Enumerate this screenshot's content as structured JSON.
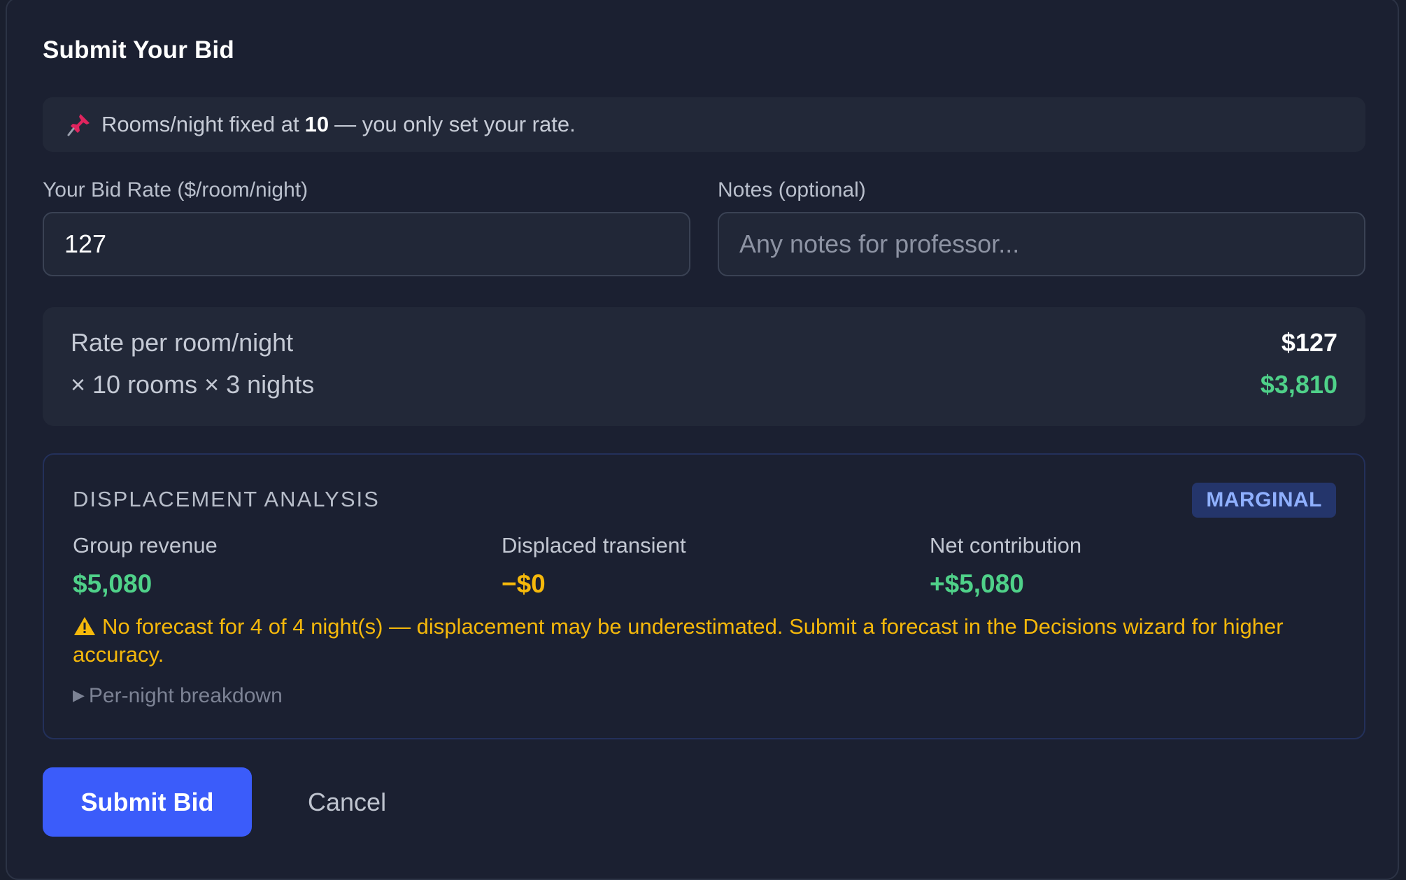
{
  "form": {
    "title": "Submit Your Bid",
    "notice": {
      "icon": "pushpin-icon",
      "prefix": "Rooms/night fixed at",
      "rooms": "10",
      "suffix": "— you only set your rate."
    },
    "bid_rate": {
      "label": "Your Bid Rate ($/room/night)",
      "value": "127"
    },
    "notes": {
      "label": "Notes (optional)",
      "value": "",
      "placeholder": "Any notes for professor..."
    }
  },
  "calculation": {
    "rate_label": "Rate per room/night",
    "rate_value": "$127",
    "total_label": "× 10 rooms × 3 nights",
    "total_value": "$3,810",
    "total_color": "#4fd189"
  },
  "displacement": {
    "title": "DISPLACEMENT ANALYSIS",
    "badge": "MARGINAL",
    "metrics": [
      {
        "label": "Group revenue",
        "value": "$5,080",
        "color": "#4fd189"
      },
      {
        "label": "Displaced transient",
        "value": "−$0",
        "color": "#f5b80b"
      },
      {
        "label": "Net contribution",
        "value": "+$5,080",
        "color": "#4fd189"
      }
    ],
    "warning": {
      "icon": "warning-icon",
      "text": "No forecast for 4 of 4 night(s) — displacement may be underestimated. Submit a forecast in the Decisions wizard for higher accuracy."
    },
    "breakdown_label": "Per-night breakdown"
  },
  "actions": {
    "submit_label": "Submit Bid",
    "cancel_label": "Cancel"
  }
}
